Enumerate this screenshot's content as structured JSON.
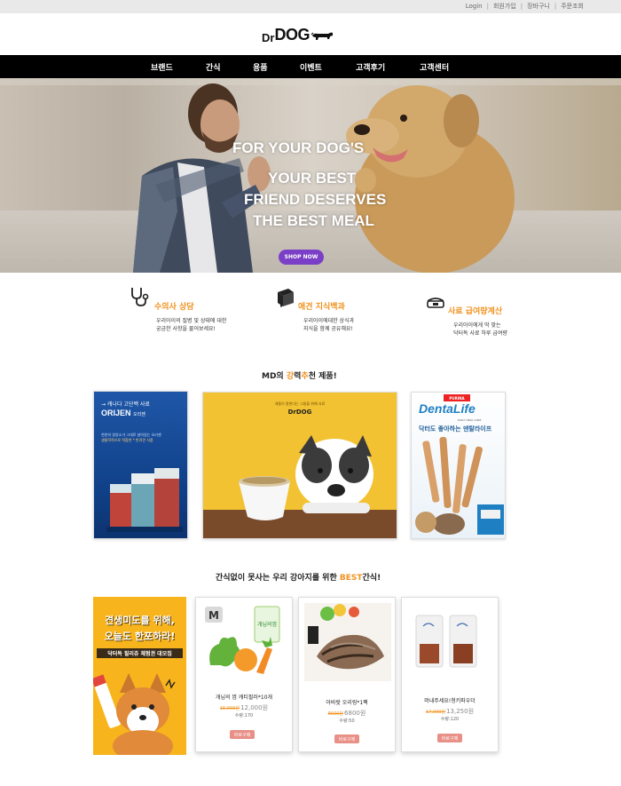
{
  "topbar": {
    "links": [
      "Login",
      "회원가입",
      "장바구니",
      "주문조회"
    ]
  },
  "logo": {
    "dr": "Dr",
    "dog": "DOG"
  },
  "nav": {
    "items": [
      "브랜드",
      "간식",
      "용품",
      "이벤트",
      "고객후기",
      "고객센터"
    ]
  },
  "hero": {
    "line1": "FOR YOUR DOG'S",
    "line2": "YOUR BEST",
    "line3": "FRIEND DESERVES",
    "line4": "THE BEST MEAL",
    "button": "SHOP NOW"
  },
  "services": [
    {
      "icon": "stethoscope-icon",
      "title": "수의사 상담",
      "desc1": "우리아이의 질병 및 상태에 대한",
      "desc2": "궁금한 사항을 물어보세요!"
    },
    {
      "icon": "book-icon",
      "title": "애견 지식백과",
      "desc1": "우리아이에대한 상식과",
      "desc2": "지식을 함께 공유해요!"
    },
    {
      "icon": "food-bowl-icon",
      "title": "사료 급여량계산",
      "desc1": "우리아이에게 딱 맞는",
      "desc2": "닥터독 사료 하루 급여량"
    }
  ],
  "md": {
    "title_pre": "MD의 ",
    "title_hl1": "강",
    "title_mid1": "력",
    "title_hl2": "추",
    "title_post": "천 제품!",
    "card1": {
      "line1": "→ 캐나다 고단백 사료",
      "brand": "ORIJEN",
      "brand_sub": "오리젠",
      "desc1": "천연의 영양소가 그대로 살아있는 오리젠",
      "desc2": "생물학적으로 적합한 * 반려견 식품"
    },
    "card2": {
      "top": "개들이 말한다는 그들을 위해 사료",
      "logo": "DrDOG"
    },
    "card3": {
      "purina": "PURINA",
      "brand": "DentaLife",
      "sub": "DAILY ORAL CARE",
      "line": "닥터도 좋아하는 덴탈라이프"
    }
  },
  "snacks": {
    "title_pre": "간식없이 못사는 우리 강아지를 위한 ",
    "title_hl": "BEST",
    "title_post": "간식!",
    "banner": {
      "line1": "견생미도를 위해,",
      "line2": "오늘도 한포하라!",
      "line3": "닥터독 필리쥬 체험권 대모집"
    },
    "items": [
      {
        "name": "개님의 껌 캐티필러*10개",
        "old_price": "15,000원",
        "price": "12,000원",
        "stock": "수량:170",
        "buy": "바로구매",
        "package_text": "개님의껌"
      },
      {
        "name": "아바랏 오리링*1팩",
        "old_price": "8000원",
        "price": "6800원",
        "stock": "수량:50",
        "buy": "바로구매"
      },
      {
        "name": "머내주세요!청키파우더",
        "old_price": "17,000원",
        "price": "13,250원",
        "stock": "수량:120",
        "buy": "바로구매"
      }
    ]
  },
  "colors": {
    "accent": "#f0921e",
    "nav_bg": "#000000",
    "shop_btn": "#7a3fc6",
    "buy_btn": "#e88f86"
  }
}
